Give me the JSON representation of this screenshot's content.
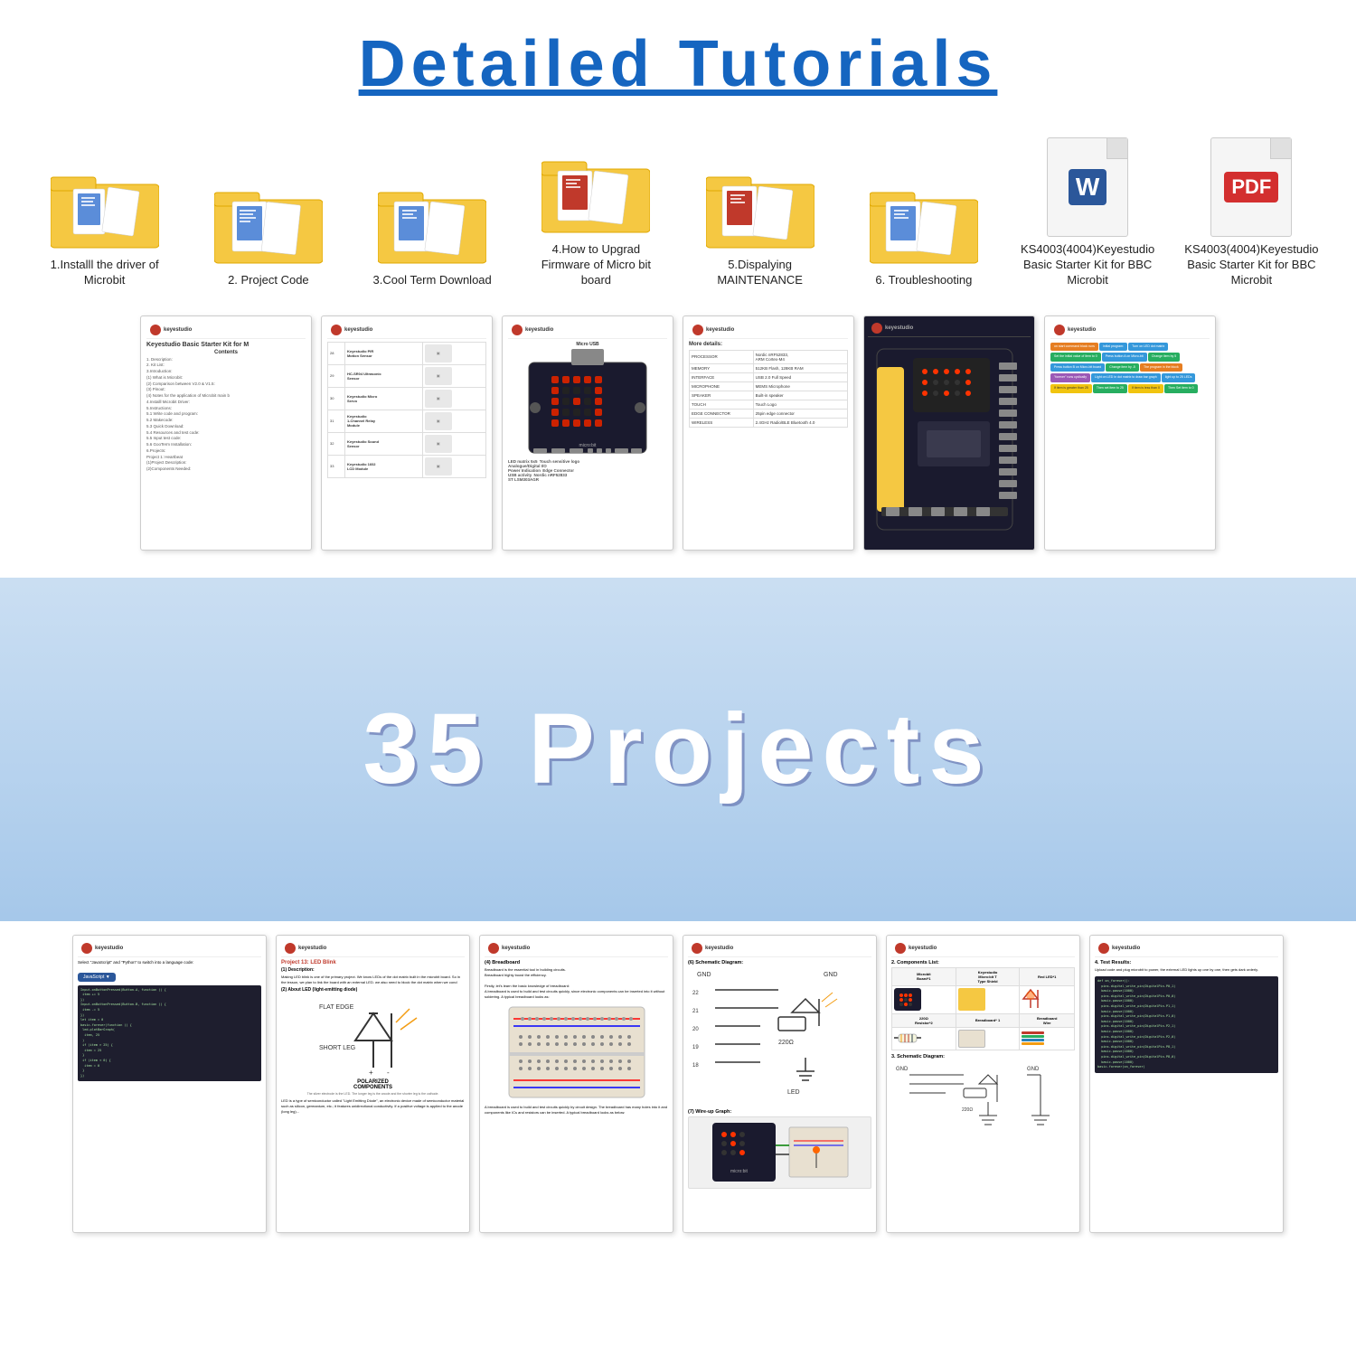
{
  "header": {
    "title": "Detailed  Tutorials"
  },
  "folders": [
    {
      "id": "folder-1",
      "label": "1.Installl the driver of Microbit",
      "type": "folder"
    },
    {
      "id": "folder-2",
      "label": "2. Project Code",
      "type": "folder"
    },
    {
      "id": "folder-3",
      "label": "3.Cool Term Download",
      "type": "folder"
    },
    {
      "id": "folder-4",
      "label": "4.How to Upgrad Firmware of\nMicro bit board",
      "type": "folder"
    },
    {
      "id": "folder-5",
      "label": "5.Dispalying MAINTENANCE",
      "type": "folder"
    },
    {
      "id": "folder-6",
      "label": "6. Troubleshooting",
      "type": "folder"
    },
    {
      "id": "file-word",
      "label": "KS4003(4004)Keyestudio Basic Starter Kit for BBC Microbit",
      "type": "word"
    },
    {
      "id": "file-pdf",
      "label": "KS4003(4004)Keyestudio Basic Starter Kit for BBC Microbit",
      "type": "pdf"
    }
  ],
  "projects_count": "35  Projects",
  "doc_pages": {
    "page1_title": "Keyestudio Basic Starter Kit for M",
    "page1_contents": "Contents\n1. Description:\n2. Kit List:\n3.Introduction:\n(1) What is Microbit:\n(2) Comparison between V2.0 & V1.5:\n(3) Pinout:\n(4) Notes for the application of Microbit main b\n4.Installl Microbit Driver:\n5.Instructions:\n5.1 Write code and program:\n5.2 Makecode:\n5.3 Quick Download:\n5.4 Resources and test code:\n5.5 Input test code:\n5.6 GooTerm Installation:\n6.Projects:\nProject 1: Heartbeat\n(1)Project Description:\n(2)Components Needed:",
    "page3_usb": "Micro USB",
    "page3_led": "LED matrix 5x5",
    "page3_touch": "Touch sensitive logo",
    "page3_analog": "Analogue/Digital I/O",
    "page3_power": "Power Indicatio",
    "page3_edge": "Edge Connector",
    "page3_usb_act": "USB activity",
    "page3_nordic": "Nordic nRF52833",
    "page3_st": "ST LSM303AGR",
    "page6_title": "More details:",
    "projects_label": "35  Projects"
  },
  "colors": {
    "accent_blue": "#1565C0",
    "folder_yellow": "#F5C842",
    "doc_white": "#ffffff"
  }
}
